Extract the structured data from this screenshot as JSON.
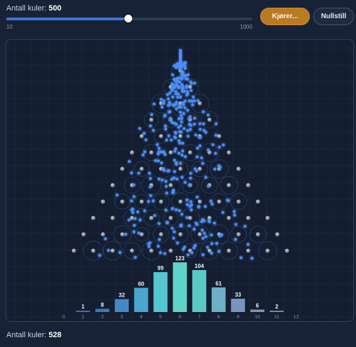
{
  "controls": {
    "ball_count_label": "Antall kuler:",
    "ball_count_value": "500",
    "slider_min_label": "10",
    "slider_max_label": "1000",
    "slider_value": 500,
    "slider_min": 10,
    "slider_max": 1000,
    "run_button": "Kjører...",
    "reset_button": "Nullstill"
  },
  "board": {
    "peg_rows": 12,
    "colors": {
      "background": "#141e30",
      "peg": "#8d95a3",
      "ball": "#4d8df5",
      "stream": "#4f8ff7"
    }
  },
  "histogram": {
    "bins": [
      "0",
      "1",
      "2",
      "3",
      "4",
      "5",
      "6",
      "7",
      "8",
      "9",
      "10",
      "11",
      "12"
    ],
    "counts": [
      0,
      1,
      8,
      32,
      60,
      99,
      123,
      104,
      61,
      33,
      6,
      2,
      0
    ],
    "value_labels": [
      "",
      "1",
      "8",
      "32",
      "60",
      "99",
      "123",
      "104",
      "61",
      "33",
      "6",
      "2",
      ""
    ],
    "bar_colors": [
      "#3d5f9e",
      "#3f6cb0",
      "#4177bd",
      "#4488c6",
      "#48a6cf",
      "#55c6d0",
      "#5fd3c8",
      "#59c9c6",
      "#6db0c8",
      "#7a94bf",
      "#8a8fb5",
      "#7c86ad",
      "#6e7aa0"
    ]
  },
  "footer": {
    "ball_total_label": "Antall kuler:",
    "ball_total_value": "528"
  }
}
